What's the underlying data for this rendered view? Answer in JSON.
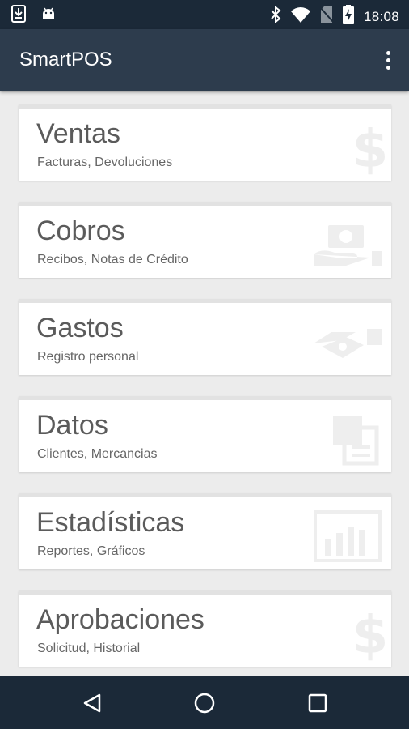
{
  "status_bar": {
    "time": "18:08",
    "icons": [
      "download-icon",
      "android-icon",
      "bluetooth-icon",
      "wifi-icon",
      "no-sim-icon",
      "battery-charging-icon"
    ]
  },
  "app_bar": {
    "title": "SmartPOS",
    "overflow_icon": "more-vert-icon"
  },
  "menu": {
    "items": [
      {
        "title": "Ventas",
        "subtitle": "Facturas, Devoluciones",
        "icon": "dollar-icon"
      },
      {
        "title": "Cobros",
        "subtitle": "Recibos, Notas de Crédito",
        "icon": "cash-hand-icon"
      },
      {
        "title": "Gastos",
        "subtitle": "Registro personal",
        "icon": "payment-handshake-icon"
      },
      {
        "title": "Datos",
        "subtitle": "Clientes, Mercancias",
        "icon": "documents-icon"
      },
      {
        "title": "Estadísticas",
        "subtitle": "Reportes, Gráficos",
        "icon": "bar-chart-icon"
      },
      {
        "title": "Aprobaciones",
        "subtitle": "Solicitud, Historial",
        "icon": "dollar-icon"
      }
    ]
  },
  "nav_bar": {
    "icons": [
      "back-icon",
      "home-icon",
      "recents-icon"
    ]
  },
  "colors": {
    "status_bar": "#1b2938",
    "app_bar": "#2d3c4d",
    "background": "#ececec",
    "card": "#ffffff",
    "watermark_icon": "#eeeeee"
  }
}
